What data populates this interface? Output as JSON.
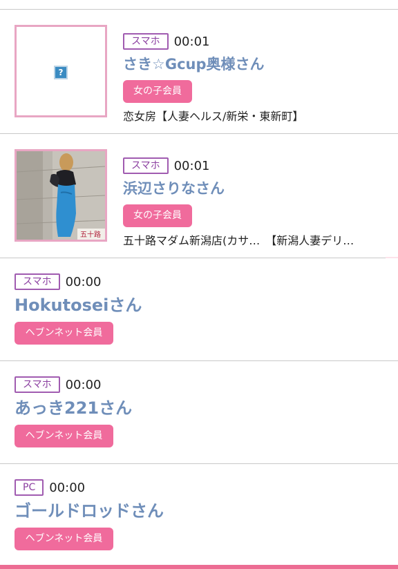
{
  "entries": [
    {
      "device": "スマホ",
      "time": "00:01",
      "name": "さき☆Gcup奥様さん",
      "member": "女の子会員",
      "shop": "恋女房【人妻ヘルス/新栄・東新町】",
      "thumb": "broken-image-icon",
      "broken_glyph": "?"
    },
    {
      "device": "スマホ",
      "time": "00:01",
      "name": "浜辺さりなさん",
      "member": "女の子会員",
      "shop": "五十路マダム新潟店(カサ…　【新潟人妻デリ…",
      "thumb": "photo"
    },
    {
      "device": "スマホ",
      "time": "00:00",
      "name": "Hokutoseiさん",
      "member": "ヘブンネット会員"
    },
    {
      "device": "スマホ",
      "time": "00:00",
      "name": "あっき221さん",
      "member": "ヘブンネット会員"
    },
    {
      "device": "PC",
      "time": "00:00",
      "name": "ゴールドロッドさん",
      "member": "ヘブンネット会員"
    }
  ],
  "colors": {
    "name": "#6f8eb9",
    "badge_border": "#a05bb0",
    "member_pill": "#f06b9c",
    "thumb_border": "#e8a6c3",
    "accent_strip": "#fce3ea",
    "bottom_bar": "#ec6c93"
  }
}
